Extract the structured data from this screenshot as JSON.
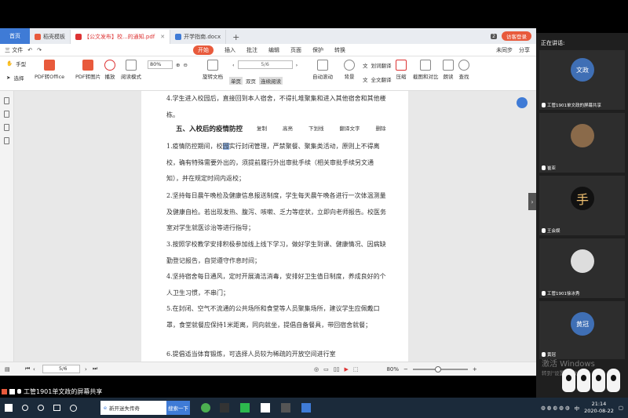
{
  "tabs": {
    "home": "首页",
    "items": [
      {
        "label": "稻壳模板",
        "color": "#e85a3c"
      },
      {
        "label": "【公文发布】校...的通知.pdf",
        "color": "#d33"
      },
      {
        "label": "开学指南.docx",
        "color": "#3f7bd6"
      }
    ],
    "count": "2",
    "login": "访客登录"
  },
  "menu": {
    "file": "三 文件",
    "center": [
      "开始",
      "插入",
      "批注",
      "编辑",
      "页面",
      "保护",
      "转换"
    ],
    "sync": "未同步",
    "share": "分享"
  },
  "toolbar": {
    "hand": "手型",
    "select": "选择",
    "buttons": [
      "PDF转Office",
      "PDF转图片",
      "播放",
      "阅读模式"
    ],
    "zoom": "80%",
    "page": "5/6",
    "rotate": "旋转文档",
    "single": "单页",
    "double": "双页",
    "continuous": "连续阅读",
    "autoscroll": "自动滚动",
    "background": "背景",
    "translate_word": "划词翻译",
    "translate_full": "全文翻译",
    "compress": "压缩",
    "screenshot": "截图和对比",
    "read": "朗读",
    "find": "查找"
  },
  "document": {
    "p_intro": "4.学生进入校园后，直接回到本人宿舍，不得扎堆聚集和进入其他宿舍和其他楼栋。",
    "heading": "五、入校后的疫情防控",
    "context_menu": [
      "复制",
      "高亮",
      "下划线",
      "翻译文字",
      "删除"
    ],
    "p1_a": "1.疫情防控期间，校",
    "p1_hl": "园",
    "p1_b": "实行封闭管理，严禁聚餐、聚集类活动，原则上不得离校，确有特殊需要外出的，须提前履行外出审批手续（相关审批手续另文通知），并在规定时间内返校；",
    "p2": "2.坚持每日晨午晚检及健康信息报送制度，学生每天晨午晚各进行一次体温测量及健康自检。若出现发热、腹泻、咳嗽、乏力等症状，立即向老师报告。校医务室对学生就医诊治等进行指导；",
    "p3": "3.按照学校教学安排积极参加线上线下学习，做好学生到课、健康情况、因病缺勤登记报告，自觉遵守作息时间；",
    "p4": "4.坚持宿舍每日通风，定时开展清洁消毒，安排好卫生值日制度，养成良好的个人卫生习惯，不串门；",
    "p5": "5.在封闭、空气不流通的公共场所和食堂等人员聚集场所，建议学生应佩戴口罩，食堂就餐应保持1米距离，同向就坐，提倡自备餐具，带回宿舍就餐；",
    "p6": "6.提倡适当体育锻炼，可选择人员较为稀疏的开放空间进行室"
  },
  "status": {
    "page": "5/6",
    "zoom": "80%"
  },
  "meeting": {
    "share_text": "工管1901单文政的屏幕共享",
    "speaking": "正在讲话:",
    "participants": [
      {
        "name": "工管1901单文政的屏幕共享",
        "avatar_text": "文政",
        "color": "#3f6fb5"
      },
      {
        "name": "崔亚",
        "avatar_text": "",
        "color": "#8a6a4a"
      },
      {
        "name": "王会娱",
        "avatar_text": "手",
        "color": "#111111"
      },
      {
        "name": "工管1901徐冰秀",
        "avatar_text": "",
        "color": "#dddddd"
      },
      {
        "name": "黄冠",
        "avatar_text": "黄冠",
        "color": "#3f6fb5"
      }
    ]
  },
  "watermark": {
    "line1": "激活 Windows",
    "line2": "转到\"设置\"以激活"
  },
  "taskbar": {
    "search_text": "新开迷失传奇",
    "search_btn": "搜索一下",
    "time": "21:14",
    "date": "2020-08-22",
    "lang": "中"
  }
}
